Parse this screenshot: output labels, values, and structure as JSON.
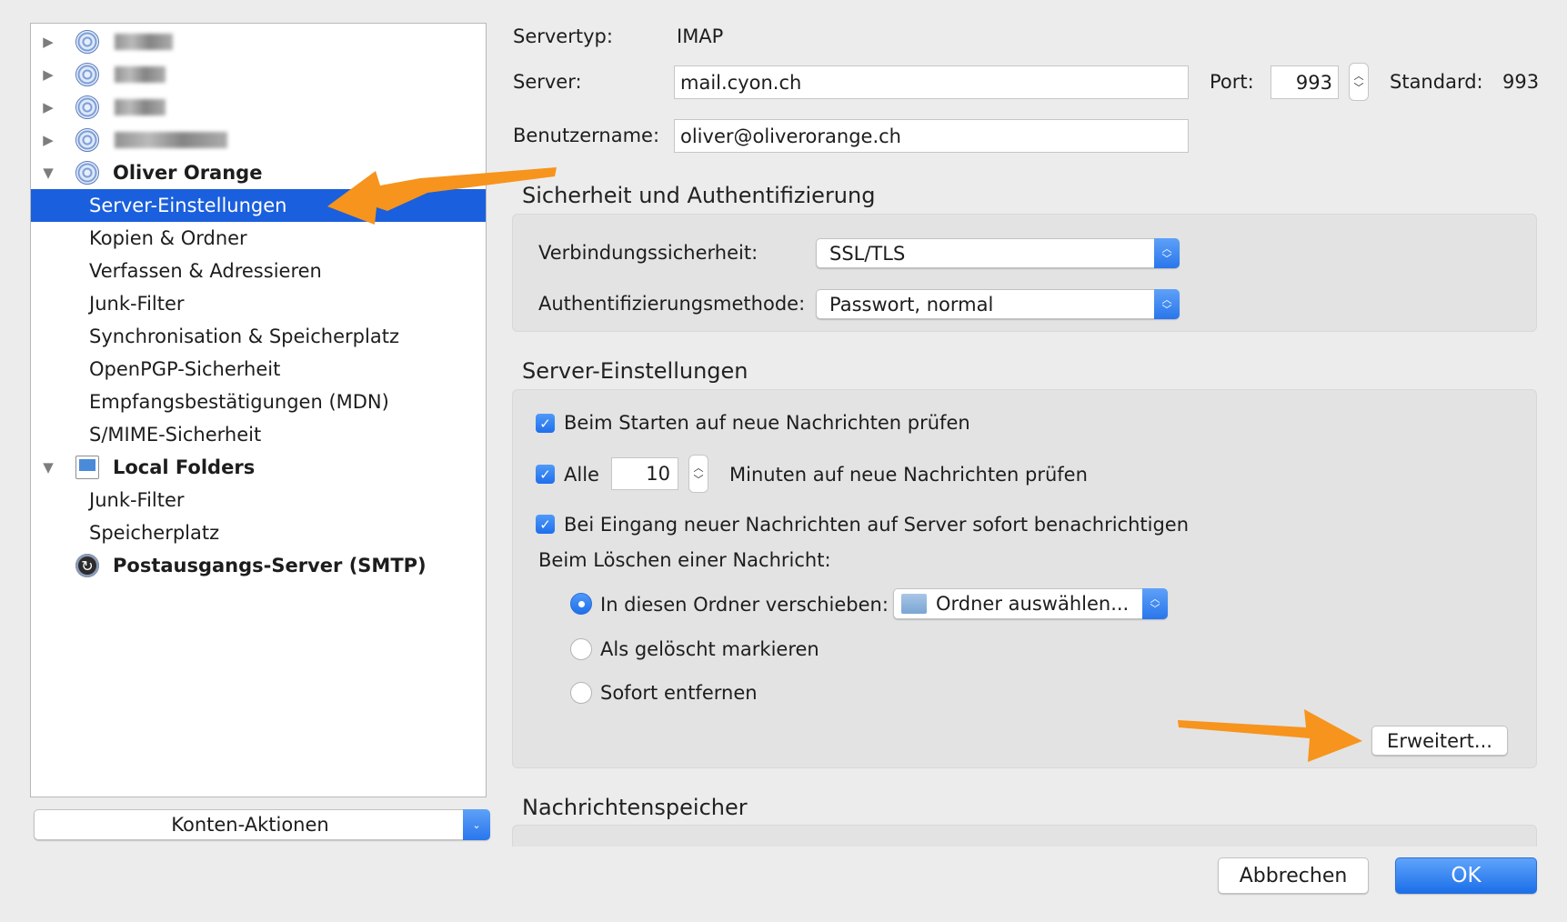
{
  "sidebar": {
    "accounts_blurred": 4,
    "account_name": "Oliver Orange",
    "account_items": [
      "Server-Einstellungen",
      "Kopien & Ordner",
      "Verfassen & Adressieren",
      "Junk-Filter",
      "Synchronisation & Speicherplatz",
      "OpenPGP-Sicherheit",
      "Empfangsbestätigungen (MDN)",
      "S/MIME-Sicherheit"
    ],
    "local_folders": "Local Folders",
    "local_items": [
      "Junk-Filter",
      "Speicherplatz"
    ],
    "smtp": "Postausgangs-Server (SMTP)",
    "account_actions": "Konten-Aktionen"
  },
  "server": {
    "type_label": "Servertyp:",
    "type_value": "IMAP",
    "server_label": "Server:",
    "server_value": "mail.cyon.ch",
    "port_label": "Port:",
    "port_value": "993",
    "standard_label": "Standard:",
    "standard_value": "993",
    "username_label": "Benutzername:",
    "username_value": "oliver@oliverorange.ch"
  },
  "security": {
    "title": "Sicherheit und Authentifizierung",
    "conn_label": "Verbindungssicherheit:",
    "conn_value": "SSL/TLS",
    "auth_label": "Authentifizierungsmethode:",
    "auth_value": "Passwort, normal"
  },
  "settings": {
    "title": "Server-Einstellungen",
    "check_start": "Beim Starten auf neue Nachrichten prüfen",
    "every_label": "Alle",
    "every_value": "10",
    "every_suffix": "Minuten auf neue Nachrichten prüfen",
    "notify": "Bei Eingang neuer Nachrichten auf Server sofort benachrichtigen",
    "delete_label": "Beim Löschen einer Nachricht:",
    "move_label": "In diesen Ordner verschieben:",
    "folder_value": "Ordner auswählen...",
    "mark_deleted": "Als gelöscht markieren",
    "remove_now": "Sofort entfernen",
    "advanced": "Erweitert..."
  },
  "storage": {
    "title": "Nachrichtenspeicher"
  },
  "footer": {
    "cancel": "Abbrechen",
    "ok": "OK"
  },
  "colors": {
    "accent": "#1a5fdd",
    "annotation": "#f7941d"
  }
}
